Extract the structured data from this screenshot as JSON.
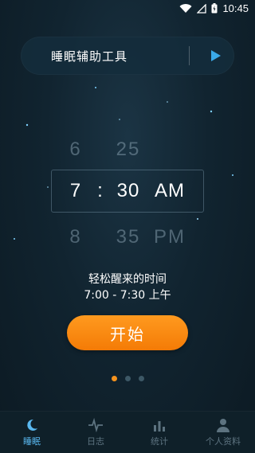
{
  "status_bar": {
    "time": "10:45",
    "icons": [
      "wifi-icon",
      "signal-icon",
      "battery-icon"
    ]
  },
  "tool_bar": {
    "title": "睡眠辅助工具",
    "play_icon": "play-icon"
  },
  "picker": {
    "above": {
      "hour": "6",
      "minute": "25"
    },
    "selected": {
      "hour": "7",
      "separator": ":",
      "minute": "30",
      "period": "AM"
    },
    "below": {
      "hour": "8",
      "minute": "35",
      "period": "PM"
    }
  },
  "wake": {
    "label": "轻松醒来的时间",
    "time_range": "7:00 - 7:30 上午"
  },
  "start_button": {
    "label": "开始"
  },
  "page_indicator": {
    "count": 3,
    "active_index": 0
  },
  "bottom_nav": [
    {
      "label": "睡眠",
      "icon": "moon-icon",
      "active": true
    },
    {
      "label": "日志",
      "icon": "pulse-icon",
      "active": false
    },
    {
      "label": "统计",
      "icon": "chart-icon",
      "active": false
    },
    {
      "label": "个人资料",
      "icon": "person-icon",
      "active": false
    }
  ],
  "colors": {
    "accent": "#f5931e",
    "nav_active": "#5ab8f0",
    "background": "#112430"
  }
}
